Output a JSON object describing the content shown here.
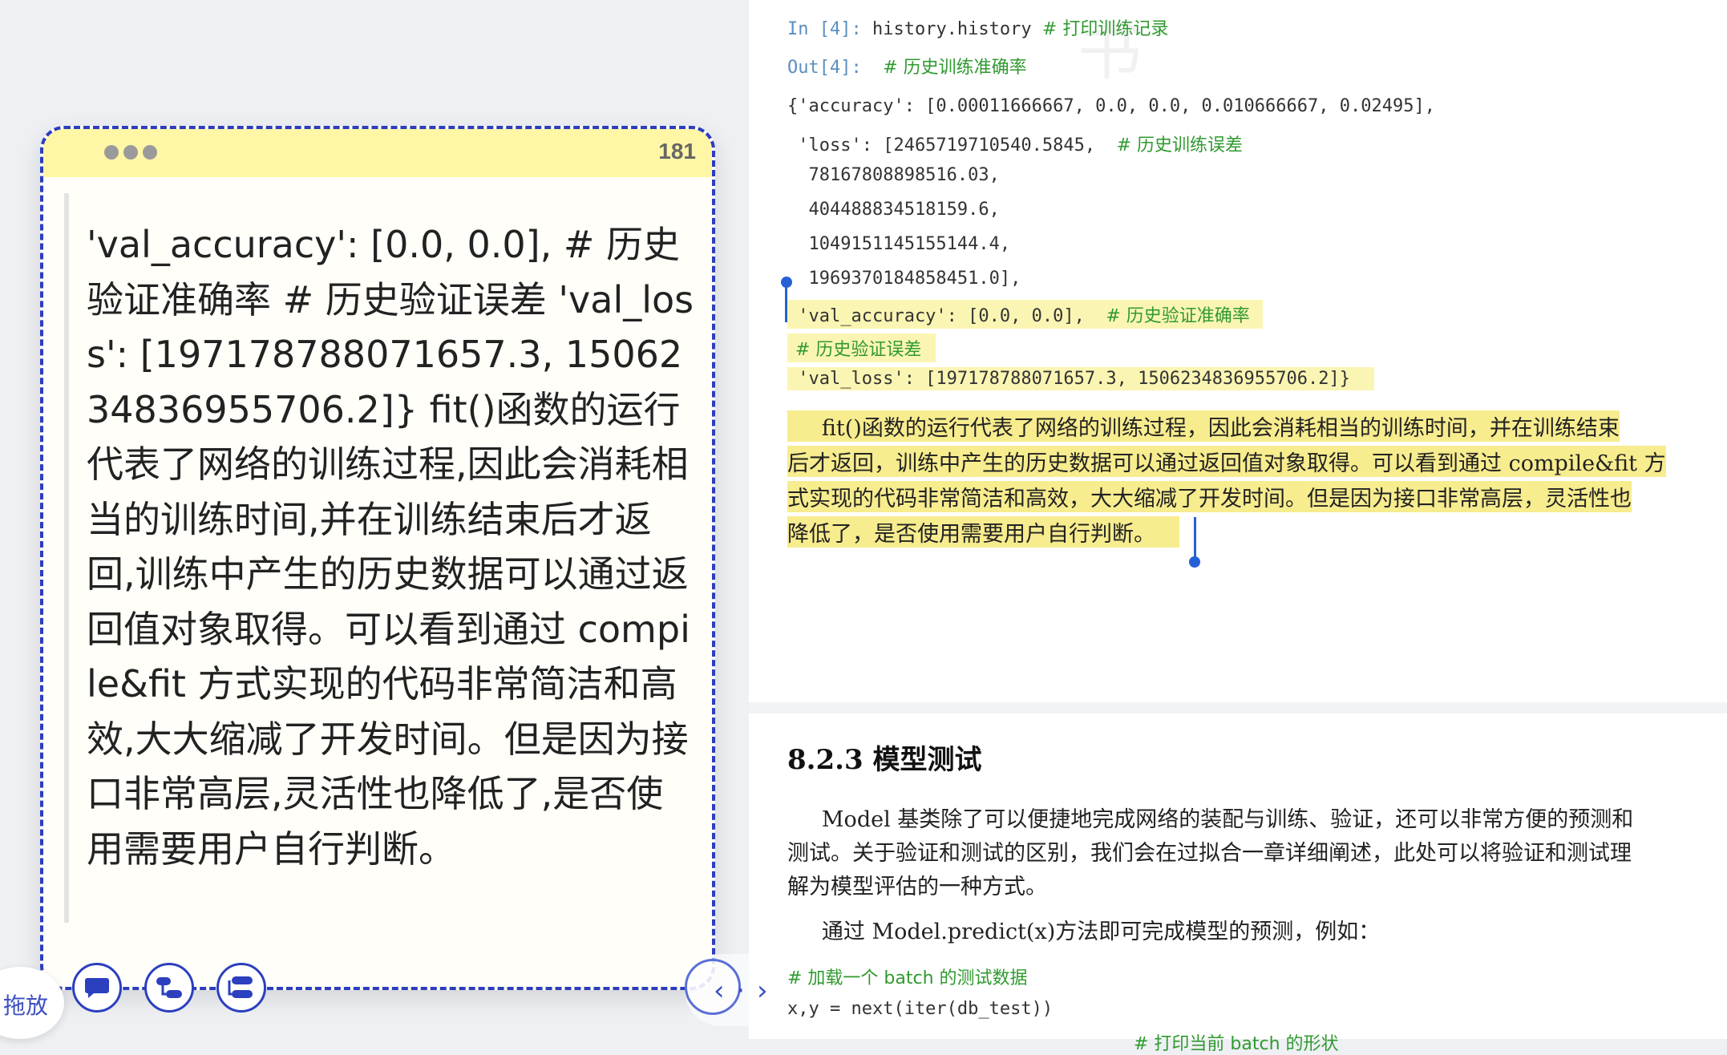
{
  "note": {
    "count": "181",
    "text": "'val_accuracy': [0.0, 0.0],  # 历史验证准确率  # 历史验证误差 'val_loss': [197178788071657.3, 1506234836955706.2]} fit()函数的运行代表了网络的训练过程,因此会消耗相当的训练时间,并在训练结束后才返回,训练中产生的历史数据可以通过返回值对象取得。可以看到通过 compile&fit 方式实现的代码非常简洁和高效,大大缩减了开发时间。但是因为接口非常高层,灵活性也降低了,是否使用需要用户自行判断。"
  },
  "toolbar": {
    "drag_label": "拖放",
    "nav_arrows": "‹ · ›"
  },
  "doc": {
    "watermark": "书",
    "in_prompt": "In [4]:",
    "in_code": "history.history",
    "in_comment": "# 打印训练记录",
    "out_prompt": "Out[4]:",
    "out_comment": "# 历史训练准确率",
    "code_lines": [
      "{'accuracy': [0.00011666667, 0.0, 0.0, 0.010666667, 0.02495],",
      " 'loss': [2465719710540.5845,",
      "  78167808898516.03,",
      "  404488834518159.6,",
      "  1049151145155144.4,",
      "  1969370184858451.0],"
    ],
    "loss_comment": "# 历史训练误差",
    "val_acc_code": " 'val_accuracy': [0.0, 0.0],",
    "val_acc_comment": "# 历史验证准确率",
    "val_loss_comment": "# 历史验证误差",
    "val_loss_code": " 'val_loss': [197178788071657.3, 1506234836955706.2]}",
    "para1": [
      "     fit()函数的运行代表了网络的训练过程，因此会消耗相当的训练时间，并在训练结束",
      "后才返回，训练中产生的历史数据可以通过返回值对象取得。可以看到通过 compile&fit 方",
      "式实现的代码非常简洁和高效，大大缩减了开发时间。但是因为接口非常高层，灵活性也",
      "降低了，是否使用需要用户自行判断。"
    ],
    "section_heading": "8.2.3 模型测试",
    "para2": [
      "     Model 基类除了可以便捷地完成网络的装配与训练、验证，还可以非常方便的预测和",
      "测试。关于验证和测试的区别，我们会在过拟合一章详细阐述，此处可以将验证和测试理",
      "解为模型评估的一种方式。"
    ],
    "para3": "     通过 Model.predict(x)方法即可完成模型的预测，例如：",
    "code_comment2": "# 加载一个 batch 的测试数据",
    "code2": "x,y = next(iter(db_test))",
    "code3_comment": "# 打印当前 batch 的形状"
  },
  "colors": {
    "accent": "#2c3dbd",
    "note_header": "#fff7a6",
    "highlight": "#fbf5b3",
    "comment": "#2f9a2f"
  },
  "icons": [
    "comment-icon",
    "mindmap-icon",
    "outline-icon"
  ]
}
